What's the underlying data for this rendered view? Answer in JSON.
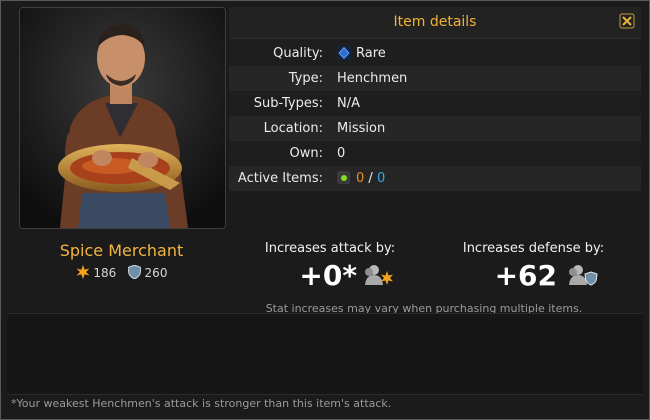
{
  "header": {
    "title": "Item details"
  },
  "item": {
    "name": "Spice Merchant",
    "attack": "186",
    "defense": "260"
  },
  "details": [
    {
      "label": "Quality:",
      "value": "Rare"
    },
    {
      "label": "Type:",
      "value": "Henchmen"
    },
    {
      "label": "Sub-Types:",
      "value": "N/A"
    },
    {
      "label": "Location:",
      "value": "Mission"
    },
    {
      "label": "Own:",
      "value": "0"
    },
    {
      "label": "Active Items:",
      "value_a": "0",
      "separator": "/",
      "value_b": "0"
    }
  ],
  "bonuses": {
    "attack_label": "Increases attack by:",
    "attack_value": "+0*",
    "defense_label": "Increases defense by:",
    "defense_value": "+62"
  },
  "notes": {
    "stat_note": "Stat increases may vary when purchasing multiple items.",
    "footer": "*Your weakest Henchmen's attack is stronger than this item's attack."
  },
  "colors": {
    "title": "#f1b330",
    "item_name": "#f4b63c",
    "rare": "#2a6fd6",
    "active_count": "#e58a25",
    "total_count": "#34a9e6"
  },
  "icons": {
    "close": "close-icon",
    "attack": "attack-icon",
    "defense": "defense-icon",
    "rarity": "rare-gem-icon",
    "active": "active-item-icon"
  }
}
